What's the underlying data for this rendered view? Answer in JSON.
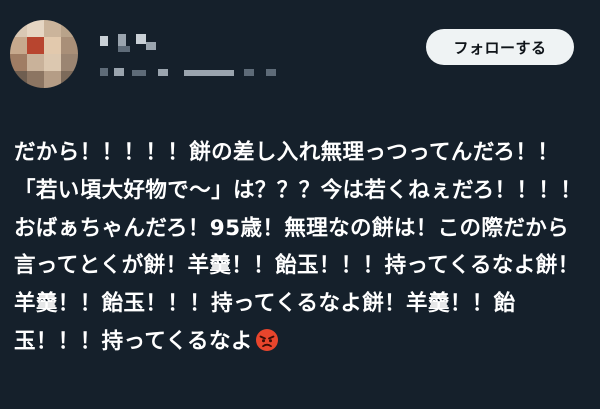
{
  "header": {
    "display_name": "(blurred)",
    "follow_button_label": "フォローする"
  },
  "post": {
    "text": "だから！！！！！餅の差し入れ無理っつってんだろ！！「若い頃大好物で〜」は？？？今は若くねぇだろ！！！！おばぁちゃんだろ！95歳！無理なの餅は！この際だから言ってとくが餅！羊羹！！飴玉！！！持ってくるなよ餅！羊羹！！飴玉！！！持ってくるなよ餅！羊羹！！飴玉！！！持ってくるなよ",
    "trailing_emoji": "angry-face-emoji"
  },
  "colors": {
    "background": "#15202b",
    "text": "#ffffff",
    "button_bg": "#eff3f4",
    "button_text": "#0f1419",
    "emoji_face": "#e8452c"
  }
}
